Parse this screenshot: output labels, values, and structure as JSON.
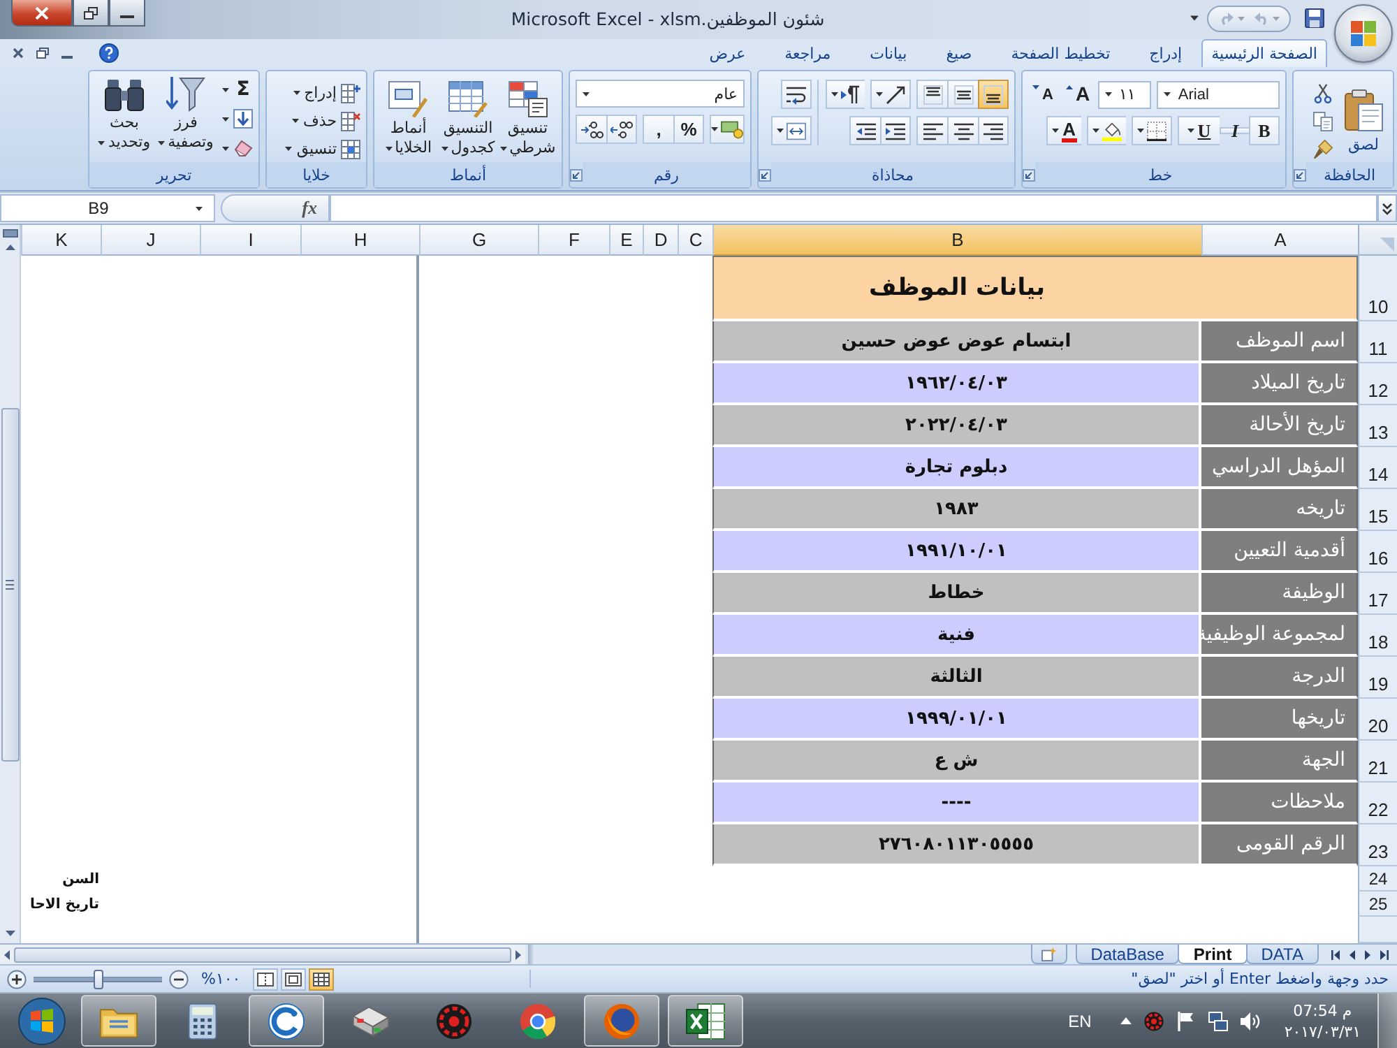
{
  "title_bar": {
    "title": "Microsoft Excel - xlsm.شئون الموظفين",
    "quick_access": [
      {
        "disabled": false
      },
      {
        "disabled": true
      },
      {
        "disabled": true
      }
    ]
  },
  "ribbon": {
    "tabs": [
      {
        "label": "الصفحة الرئيسية",
        "selected": true
      },
      {
        "label": "إدراج",
        "selected": false
      },
      {
        "label": "تخطيط الصفحة",
        "selected": false
      },
      {
        "label": "صيغ",
        "selected": false
      },
      {
        "label": "بيانات",
        "selected": false
      },
      {
        "label": "مراجعة",
        "selected": false
      },
      {
        "label": "عرض",
        "selected": false
      }
    ],
    "clipboard": {
      "label": "الحافظة",
      "paste": "لصق"
    },
    "font": {
      "label": "خط",
      "font_name": "Arial",
      "font_size": "١١",
      "grow": "A",
      "shrink": "A",
      "toggles": [
        {
          "label": "B",
          "pressed": false
        },
        {
          "label": "I",
          "pressed": false
        },
        {
          "label": "U",
          "pressed": false
        }
      ],
      "font_color": "A"
    },
    "alignment": {
      "label": "محاذاة",
      "vertical": [
        {
          "pressed": true
        },
        {
          "pressed": false
        },
        {
          "pressed": false
        }
      ],
      "horizontal": [
        {
          "pressed": false
        },
        {
          "pressed": false
        },
        {
          "pressed": false
        }
      ]
    },
    "number": {
      "label": "رقم",
      "format": "عام",
      "percent": "%",
      "comma": ","
    },
    "styles": {
      "label": "أنماط",
      "buttons": [
        [
          "تنسيق",
          "شرطي"
        ],
        [
          "التنسيق",
          "كجدول"
        ],
        [
          "أنماط",
          "الخلايا"
        ]
      ]
    },
    "cells": {
      "label": "خلايا",
      "buttons": [
        "إدراج",
        "حذف",
        "تنسيق"
      ]
    },
    "editing": {
      "label": "تحرير",
      "sum": "Σ",
      "buttons": [
        [
          "فرز",
          "وتصفية"
        ],
        [
          "بحث",
          "وتحديد"
        ]
      ]
    }
  },
  "formula_bar": {
    "name_box": "B9",
    "function_label": "fx"
  },
  "sheet": {
    "columns": [
      {
        "label": "A",
        "selected": false
      },
      {
        "label": "B",
        "selected": true
      },
      {
        "label": "C",
        "selected": false
      },
      {
        "label": "D",
        "selected": false
      },
      {
        "label": "E",
        "selected": false
      },
      {
        "label": "F",
        "selected": false
      },
      {
        "label": "G",
        "selected": false
      },
      {
        "label": "H",
        "selected": false
      },
      {
        "label": "I",
        "selected": false
      },
      {
        "label": "J",
        "selected": false
      },
      {
        "label": "K",
        "selected": false
      }
    ],
    "title_row": {
      "row": "10",
      "title": "بيانات الموظف"
    },
    "rows": [
      {
        "row": "11",
        "label": "اسم الموظف",
        "value": "ابتسام عوض عوض حسين"
      },
      {
        "row": "12",
        "label": "تاريخ الميلاد",
        "value": "١٩٦٢/٠٤/٠٣"
      },
      {
        "row": "13",
        "label": "تاريخ الأحالة",
        "value": "٢٠٢٢/٠٤/٠٣"
      },
      {
        "row": "14",
        "label": "المؤهل الدراسي",
        "value": "دبلوم تجارة"
      },
      {
        "row": "15",
        "label": "تاريخه",
        "value": "١٩٨٣"
      },
      {
        "row": "16",
        "label": "أقدمية التعيين",
        "value": "١٩٩١/١٠/٠١"
      },
      {
        "row": "17",
        "label": "الوظيفة",
        "value": "خطاط"
      },
      {
        "row": "18",
        "label": "لمجموعة الوظيفية",
        "value": "فنية"
      },
      {
        "row": "19",
        "label": "الدرجة",
        "value": "الثالثة"
      },
      {
        "row": "20",
        "label": "تاريخها",
        "value": "١٩٩٩/٠١/٠١"
      },
      {
        "row": "21",
        "label": "الجهة",
        "value": "ش ع"
      },
      {
        "row": "22",
        "label": "ملاحظات",
        "value": "----"
      },
      {
        "row": "23",
        "label": "الرقم القومى",
        "value": "٢٧٦٠٨٠١١٣٠٥٥٥٥"
      }
    ],
    "extra_rows": [
      {
        "row": "24",
        "note": "السن"
      },
      {
        "row": "25",
        "note": "تاريخ الاحا"
      }
    ]
  },
  "sheet_tabs": [
    {
      "label": "DATA",
      "selected": false
    },
    {
      "label": "Print",
      "selected": true
    },
    {
      "label": "DataBase",
      "selected": false
    }
  ],
  "status_bar": {
    "zoom": {
      "label": "١٠٠%",
      "level": 0.5
    },
    "view_buttons": [
      {
        "selected": true
      },
      {
        "selected": false
      },
      {
        "selected": false
      }
    ],
    "message": "حدد وجهة واضغط Enter أو اختر \"لصق\""
  },
  "taskbar": {
    "apps": [
      {
        "running": true
      },
      {
        "running": false
      },
      {
        "running": true
      },
      {
        "running": false
      },
      {
        "running": false
      },
      {
        "running": false
      },
      {
        "running": true
      },
      {
        "running": true
      }
    ],
    "language": "EN",
    "time": "07:54 م",
    "date": "٢٠١٧/٠٣/٣١"
  }
}
